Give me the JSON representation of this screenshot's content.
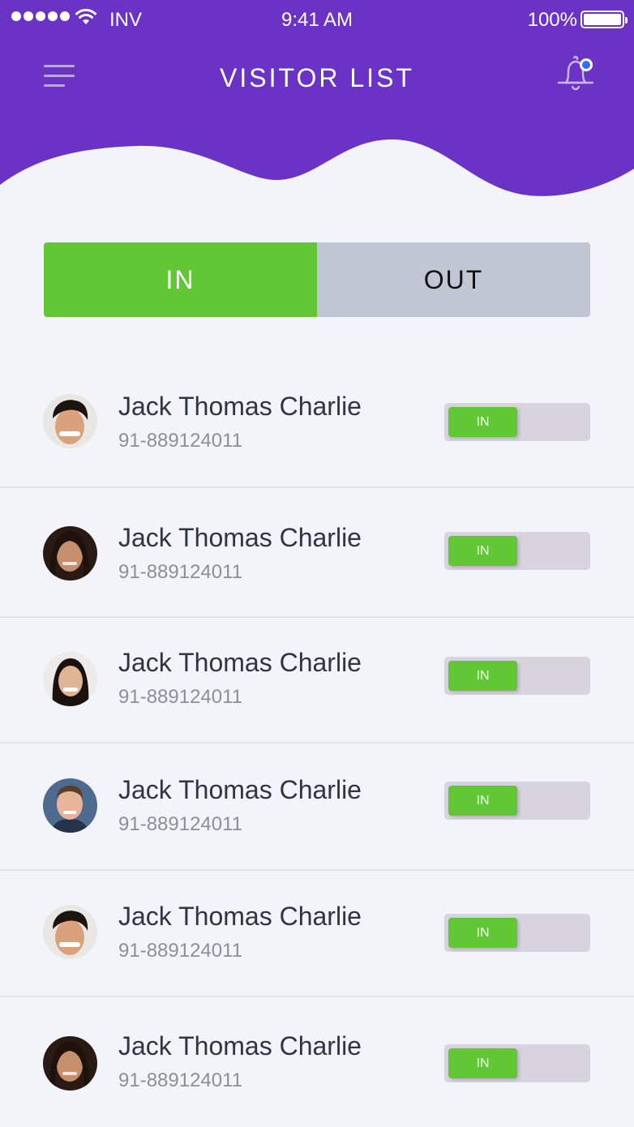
{
  "status_bar": {
    "carrier": "INV",
    "time": "9:41 AM",
    "battery": "100%"
  },
  "header": {
    "title": "VISITOR LIST"
  },
  "tabs": [
    {
      "label": "IN",
      "active": true
    },
    {
      "label": "OUT",
      "active": false
    }
  ],
  "visitors": [
    {
      "name": "Jack Thomas Charlie",
      "phone": "91-889124011",
      "status": "IN"
    },
    {
      "name": "Jack Thomas Charlie",
      "phone": "91-889124011",
      "status": "IN"
    },
    {
      "name": "Jack Thomas Charlie",
      "phone": "91-889124011",
      "status": "IN"
    },
    {
      "name": "Jack Thomas Charlie",
      "phone": "91-889124011",
      "status": "IN"
    },
    {
      "name": "Jack Thomas Charlie",
      "phone": "91-889124011",
      "status": "IN"
    },
    {
      "name": "Jack Thomas Charlie",
      "phone": "91-889124011",
      "status": "IN"
    }
  ],
  "colors": {
    "header": "#6b32c6",
    "accent_green": "#61c735",
    "tab_inactive": "#c1c6d4",
    "notification_dot": "#2f6ff5"
  },
  "icons": {
    "menu": "menu-icon",
    "notification": "bell-icon",
    "wifi": "wifi-icon",
    "battery": "battery-icon"
  }
}
